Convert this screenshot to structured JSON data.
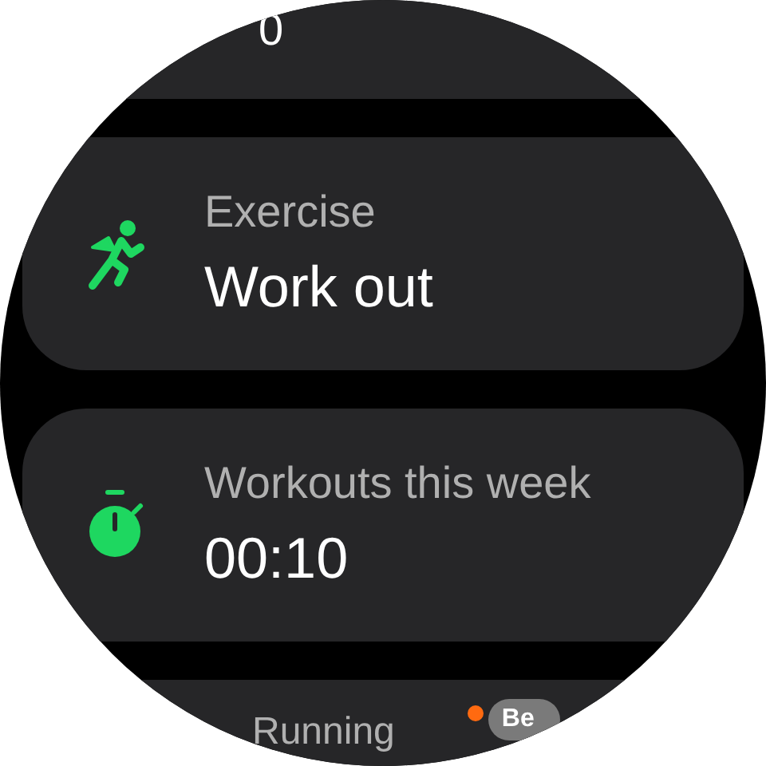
{
  "top_card": {
    "value": "0"
  },
  "tiles": [
    {
      "kind": "exercise",
      "label": "Exercise",
      "value": "Work out"
    },
    {
      "kind": "timer",
      "label": "Workouts this week",
      "value": "00:10"
    }
  ],
  "bottom_card": {
    "label": "Running",
    "new_dot": true,
    "badge": "Be"
  }
}
